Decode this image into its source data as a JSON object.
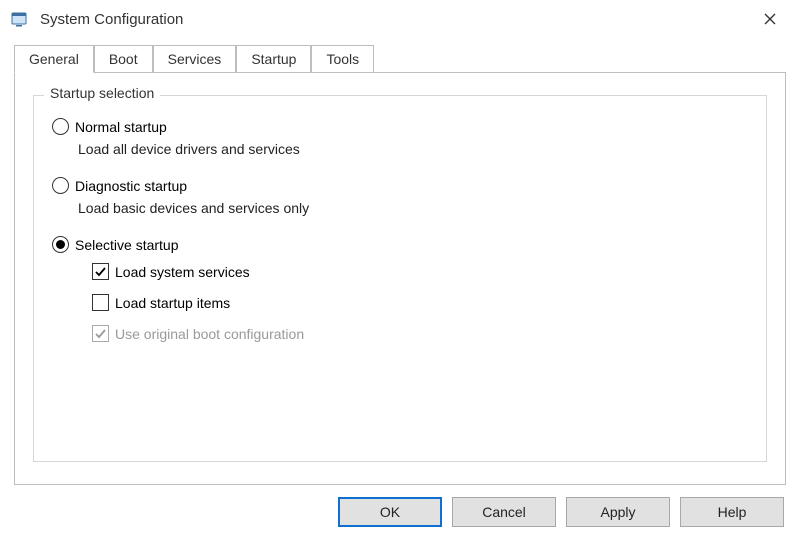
{
  "window": {
    "title": "System Configuration"
  },
  "tabs": {
    "t0": "General",
    "t1": "Boot",
    "t2": "Services",
    "t3": "Startup",
    "t4": "Tools"
  },
  "group": {
    "legend": "Startup selection",
    "normal": {
      "label": "Normal startup",
      "desc": "Load all device drivers and services"
    },
    "diagnostic": {
      "label": "Diagnostic startup",
      "desc": "Load basic devices and services only"
    },
    "selective": {
      "label": "Selective startup",
      "c1": "Load system services",
      "c2": "Load startup items",
      "c3": "Use original boot configuration"
    }
  },
  "buttons": {
    "ok": "OK",
    "cancel": "Cancel",
    "apply": "Apply",
    "help": "Help"
  }
}
